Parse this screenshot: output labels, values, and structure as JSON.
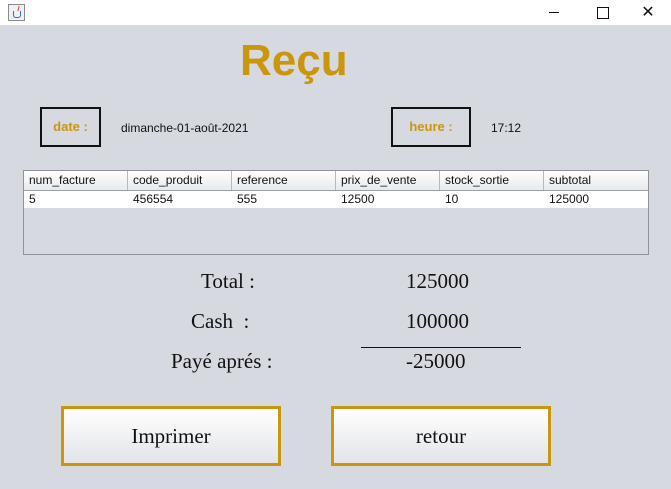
{
  "window": {
    "icon": "java-cup-icon",
    "controls": {
      "minimize": "minimize-icon",
      "maximize": "maximize-icon",
      "close": "✕"
    }
  },
  "title": "Reçu",
  "date": {
    "label": "date :",
    "value": "dimanche-01-août-2021"
  },
  "time": {
    "label": "heure :",
    "value": "17:12"
  },
  "table": {
    "columns": [
      "num_facture",
      "code_produit",
      "reference",
      "prix_de_vente",
      "stock_sortie",
      "subtotal"
    ],
    "rows": [
      [
        "5",
        "456554",
        "555",
        "12500",
        "10",
        "125000"
      ]
    ]
  },
  "summary": {
    "total_label": "Total :",
    "total_value": "125000",
    "cash_label": "Cash  :",
    "cash_value": "100000",
    "paid_label": "Payé aprés :",
    "paid_value": "-25000"
  },
  "buttons": {
    "print": "Imprimer",
    "back": "retour"
  },
  "colors": {
    "accent": "#c9960c",
    "background": "#d6d9df"
  }
}
